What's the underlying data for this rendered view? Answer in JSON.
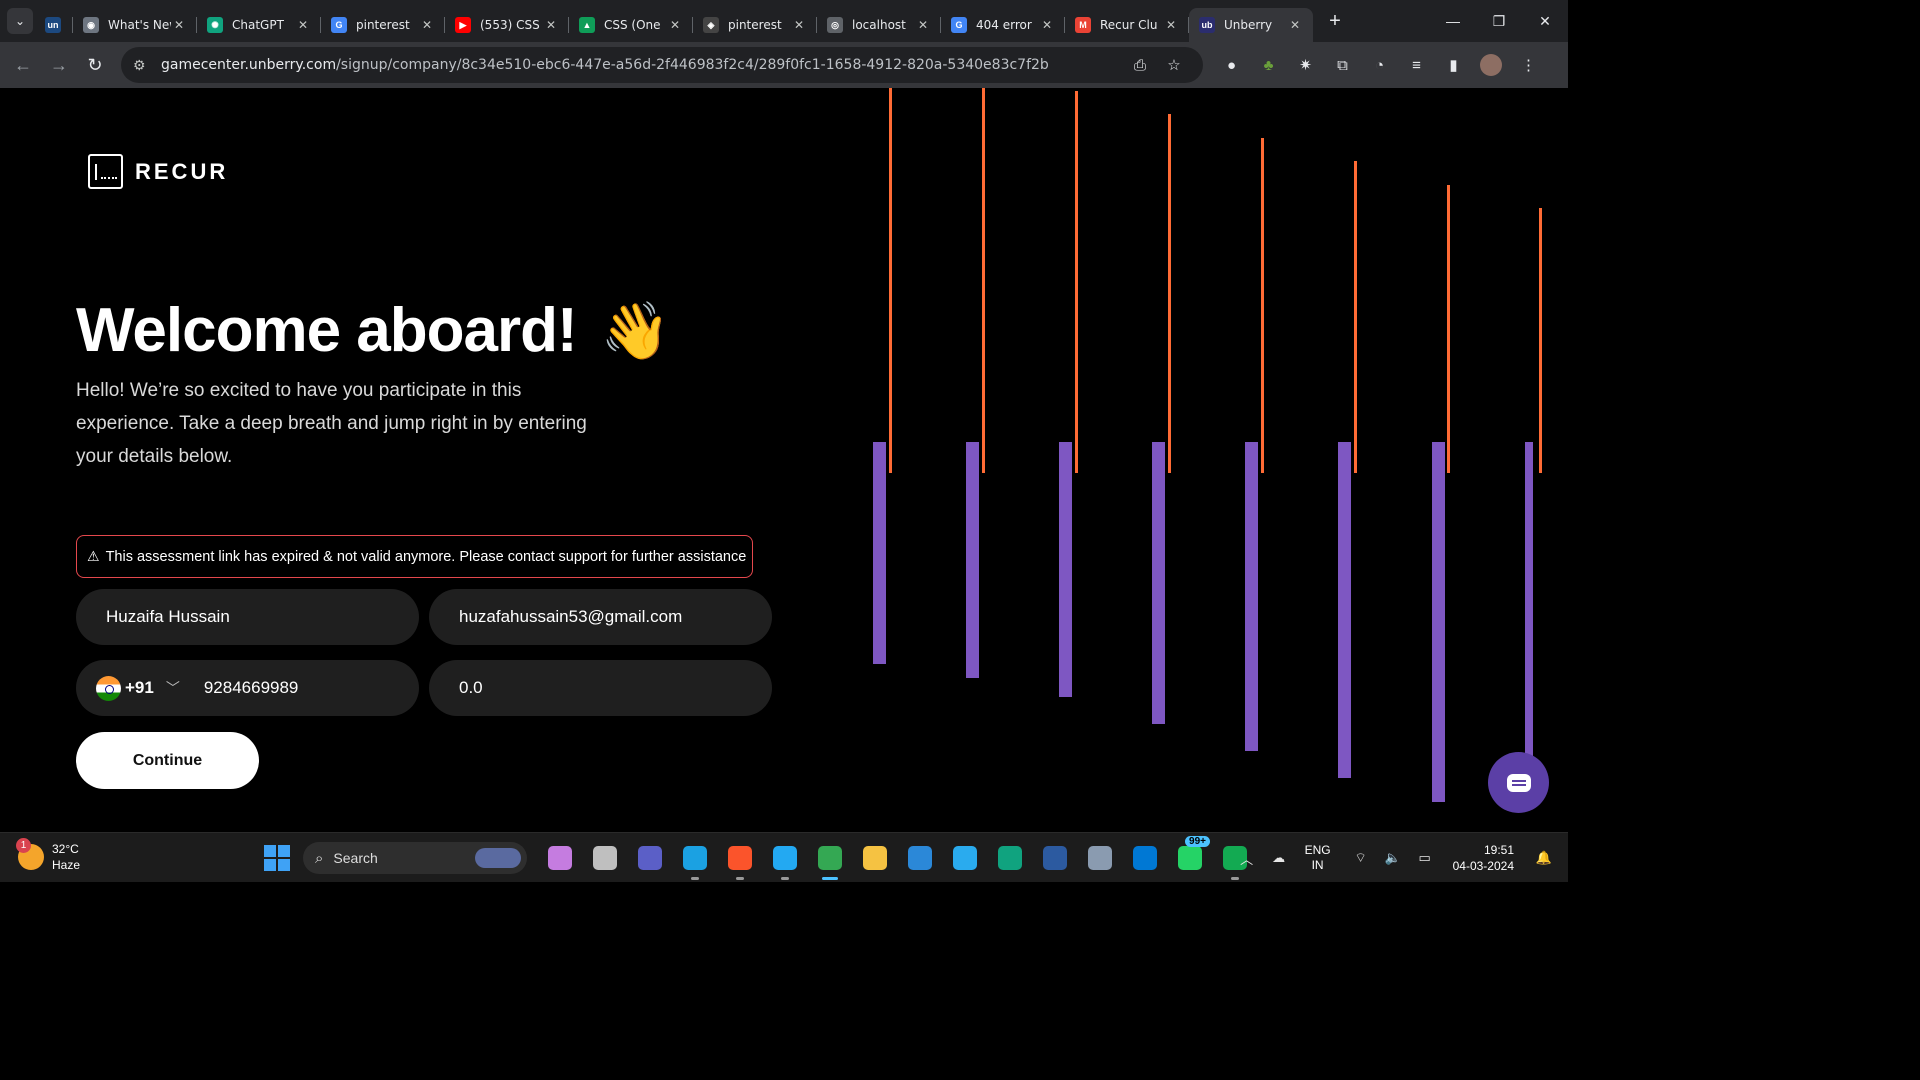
{
  "browser": {
    "tabs": [
      {
        "title": "",
        "favicon": "unstop-favicon",
        "color": "#1c4980",
        "glyph": "un",
        "pinned": true
      },
      {
        "title": "What's New",
        "favicon": "github-favicon",
        "color": "#6e7681",
        "glyph": "◉"
      },
      {
        "title": "ChatGPT",
        "favicon": "chatgpt-favicon",
        "color": "#10a37f",
        "glyph": "✺"
      },
      {
        "title": "pinterest",
        "favicon": "google-favicon",
        "color": "#4285f4",
        "glyph": "G"
      },
      {
        "title": "(553) CSS",
        "favicon": "youtube-favicon",
        "color": "#ff0000",
        "glyph": "▶"
      },
      {
        "title": "CSS (One",
        "favicon": "drive-favicon",
        "color": "#0f9d58",
        "glyph": "▲"
      },
      {
        "title": "pinterest",
        "favicon": "codepen-favicon",
        "color": "#444",
        "glyph": "◈"
      },
      {
        "title": "localhost",
        "favicon": "globe-favicon",
        "color": "#5f6368",
        "glyph": "◎"
      },
      {
        "title": "404 error",
        "favicon": "google-favicon",
        "color": "#4285f4",
        "glyph": "G"
      },
      {
        "title": "Recur Clu",
        "favicon": "gmail-favicon",
        "color": "#ea4335",
        "glyph": "M"
      },
      {
        "title": "Unberry",
        "favicon": "unberry-favicon",
        "color": "#2b2d6e",
        "glyph": "ub",
        "active": true
      }
    ],
    "url_host": "gamecenter.unberry.com",
    "url_path": "/signup/company/8c34e510-ebc6-447e-a56d-2f446983f2c4/289f0fc1-1658-4912-820a-5340e83c7f2b"
  },
  "page": {
    "logo_text": "RECUR",
    "headline": "Welcome aboard!",
    "wave_emoji": "👋",
    "intro": "Hello! We’re so excited to have you participate in this experience. Take a deep breath and jump right in by entering your details below.",
    "alert_icon": "⚠",
    "alert_text": "This assessment link has expired & not valid anymore. Please contact support for further assistance",
    "form": {
      "name_value": "Huzaifa Hussain",
      "email_value": "huzafahussain53@gmail.com",
      "country_code": "+91",
      "phone_value": "9284669989",
      "experience_value": "0.0",
      "continue_label": "Continue"
    },
    "colors": {
      "accent_orange": "#ff6b35",
      "accent_purple": "#7e57c2",
      "error_border": "#e5484d"
    }
  },
  "taskbar": {
    "weather_temp": "32°C",
    "weather_desc": "Haze",
    "weather_badge": "1",
    "search_label": "Search",
    "apps": [
      {
        "name": "copilot-icon",
        "color": "#c57ce0"
      },
      {
        "name": "task-view-icon",
        "color": "#bfbfbf"
      },
      {
        "name": "teams-icon",
        "color": "#5b5fc7"
      },
      {
        "name": "edge-icon",
        "color": "#1ba1e2",
        "run": true
      },
      {
        "name": "brave-icon",
        "color": "#fb542b",
        "run": true
      },
      {
        "name": "vscode-icon",
        "color": "#23a9f2",
        "run": true
      },
      {
        "name": "chrome-icon",
        "color": "#34a853",
        "run": true,
        "active": true
      },
      {
        "name": "file-explorer-icon",
        "color": "#f5c242"
      },
      {
        "name": "mail-icon",
        "color": "#2b88d8"
      },
      {
        "name": "telegram-icon",
        "color": "#2aabee"
      },
      {
        "name": "chatgpt-app-icon",
        "color": "#10a37f"
      },
      {
        "name": "powershell-icon",
        "color": "#2c5aa0"
      },
      {
        "name": "settings-icon",
        "color": "#8a9bb0"
      },
      {
        "name": "store-icon",
        "color": "#0078d4"
      },
      {
        "name": "whatsapp-icon",
        "color": "#25d366",
        "count": "99+"
      },
      {
        "name": "mongodb-icon",
        "color": "#13aa52",
        "run": true
      }
    ],
    "lang_top": "ENG",
    "lang_bottom": "IN",
    "time": "19:51",
    "date": "04-03-2024"
  }
}
